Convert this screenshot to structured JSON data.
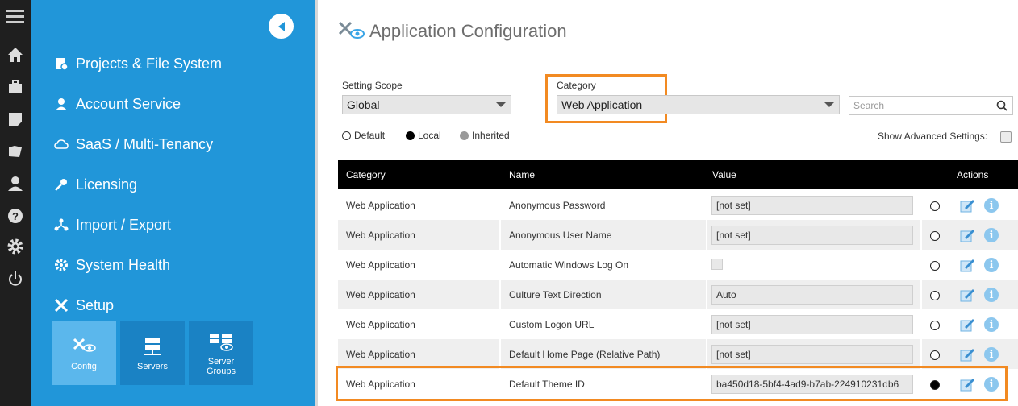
{
  "nav": {
    "items": [
      {
        "label": "Projects & File System",
        "icon": "projects-icon"
      },
      {
        "label": "Account Service",
        "icon": "user-icon"
      },
      {
        "label": "SaaS / Multi-Tenancy",
        "icon": "cloud-icon"
      },
      {
        "label": "Licensing",
        "icon": "key-icon"
      },
      {
        "label": "Import / Export",
        "icon": "import-export-icon"
      },
      {
        "label": "System Health",
        "icon": "gear-icon"
      },
      {
        "label": "Setup",
        "icon": "tools-icon"
      }
    ],
    "tiles": [
      {
        "label": "Config",
        "icon": "config-icon"
      },
      {
        "label": "Servers",
        "icon": "servers-icon"
      },
      {
        "label": "Server Groups",
        "icon": "server-groups-icon"
      }
    ]
  },
  "page": {
    "title": "Application Configuration"
  },
  "filters": {
    "scope_label": "Setting Scope",
    "scope_value": "Global",
    "category_label": "Category",
    "category_value": "Web Application",
    "search_placeholder": "Search",
    "radio_default": "Default",
    "radio_local": "Local",
    "radio_inherited": "Inherited",
    "advanced_label": "Show Advanced Settings:"
  },
  "table": {
    "headers": {
      "category": "Category",
      "name": "Name",
      "value": "Value",
      "actions": "Actions"
    },
    "rows": [
      {
        "category": "Web Application",
        "name": "Anonymous Password",
        "value": "[not set]"
      },
      {
        "category": "Web Application",
        "name": "Anonymous User Name",
        "value": "[not set]"
      },
      {
        "category": "Web Application",
        "name": "Automatic Windows Log On",
        "value": ""
      },
      {
        "category": "Web Application",
        "name": "Culture Text Direction",
        "value": "Auto"
      },
      {
        "category": "Web Application",
        "name": "Custom Logon URL",
        "value": "[not set]"
      },
      {
        "category": "Web Application",
        "name": "Default Home Page (Relative Path)",
        "value": "[not set]"
      },
      {
        "category": "Web Application",
        "name": "Default Theme ID",
        "value": "ba450d18-5bf4-4ad9-b7ab-224910231db6"
      }
    ]
  },
  "colors": {
    "nav_bg": "#2196d9",
    "highlight": "#f28a22",
    "rail_bg": "#1f1f1f"
  }
}
